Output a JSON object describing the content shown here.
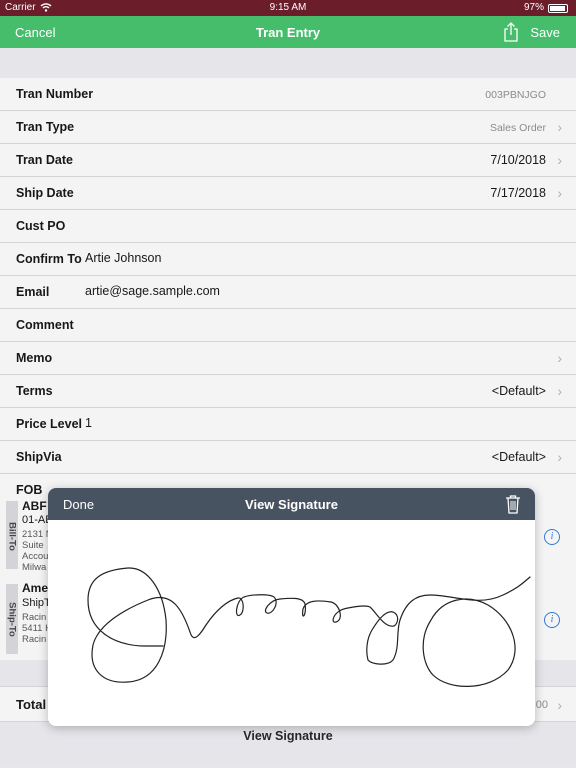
{
  "status": {
    "carrier": "Carrier",
    "time": "9:15 AM",
    "battery": "97%"
  },
  "nav": {
    "cancel": "Cancel",
    "title": "Tran Entry",
    "save": "Save"
  },
  "form": {
    "rows": [
      {
        "label": "Tran Number",
        "value": "",
        "right": "003PBNJGO",
        "muted": true,
        "chevron": false
      },
      {
        "label": "Tran Type",
        "value": "",
        "right": "Sales Order",
        "muted": true,
        "chevron": true
      },
      {
        "label": "Tran Date",
        "value": "",
        "right": "7/10/2018",
        "muted": false,
        "chevron": true
      },
      {
        "label": "Ship Date",
        "value": "",
        "right": "7/17/2018",
        "muted": false,
        "chevron": true
      },
      {
        "label": "Cust PO",
        "value": "",
        "right": "",
        "muted": false,
        "chevron": false
      },
      {
        "label": "Confirm To",
        "value": "Artie Johnson",
        "right": "",
        "muted": false,
        "chevron": false
      },
      {
        "label": "Email",
        "value": "artie@sage.sample.com",
        "right": "",
        "muted": false,
        "chevron": false
      },
      {
        "label": "Comment",
        "value": "",
        "right": "",
        "muted": false,
        "chevron": false
      },
      {
        "label": "Memo",
        "value": "",
        "right": "",
        "muted": false,
        "chevron": true
      },
      {
        "label": "Terms",
        "value": "",
        "right": "<Default>",
        "muted": false,
        "chevron": true
      },
      {
        "label": "Price Level",
        "value": "1",
        "right": "",
        "muted": false,
        "chevron": false
      },
      {
        "label": "ShipVia",
        "value": "",
        "right": "<Default>",
        "muted": false,
        "chevron": true
      },
      {
        "label": "FOB",
        "value": "",
        "right": "",
        "muted": false,
        "chevron": false
      }
    ]
  },
  "bill_to": {
    "tab": "Bill-To",
    "name": "ABF",
    "lines": [
      "01-AE",
      "2131 N",
      "Suite",
      "Accou",
      "Milwa"
    ]
  },
  "ship_to": {
    "tab": "Ship-To",
    "name": "Ame",
    "lines": [
      "ShipT",
      "Racin",
      "5411 H",
      "Racin"
    ]
  },
  "icons": {
    "info": "info-icon",
    "chevron": "chevron-right-icon",
    "share": "share-icon",
    "trash": "trash-icon"
  },
  "total": {
    "label": "Total",
    "amount": "00"
  },
  "bottom_button": "View Signature",
  "modal": {
    "done": "Done",
    "title": "View Signature"
  },
  "colors": {
    "status_bar": "#6b1d2a",
    "nav_bar": "#46bd6b",
    "modal_header": "#485361",
    "link": "#2f7be0"
  }
}
